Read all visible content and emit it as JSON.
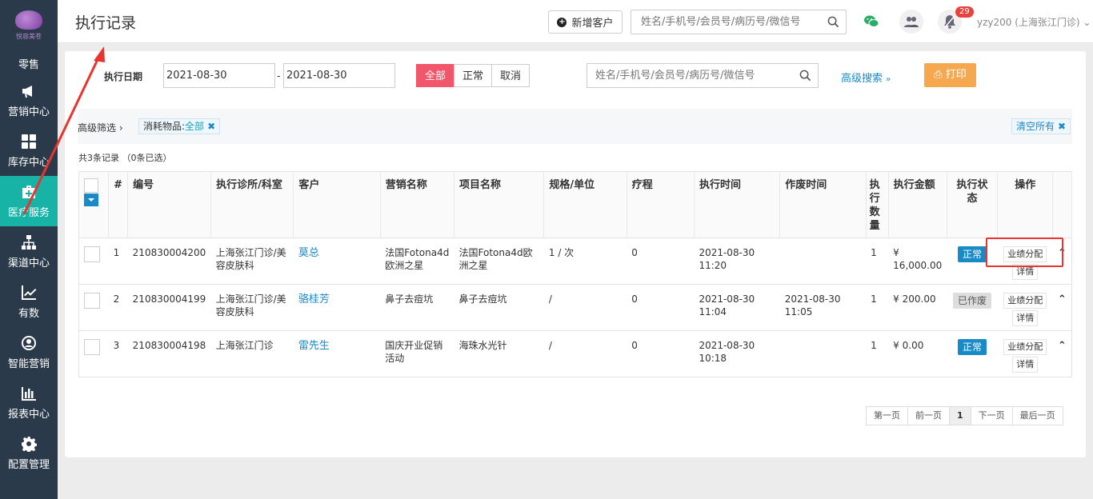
{
  "brand": {
    "logo_text": "悦容美苍"
  },
  "sidebar": {
    "items": [
      {
        "label": "零售",
        "icon": "retail-icon"
      },
      {
        "label": "营销中心",
        "icon": "megaphone-icon"
      },
      {
        "label": "库存中心",
        "icon": "grid-icon"
      },
      {
        "label": "医疗服务",
        "icon": "medical-kit-icon",
        "active": true
      },
      {
        "label": "渠道中心",
        "icon": "hierarchy-icon"
      },
      {
        "label": "有数",
        "icon": "trend-chart-icon"
      },
      {
        "label": "智能营销",
        "icon": "smart-icon"
      },
      {
        "label": "报表中心",
        "icon": "bar-chart-icon"
      },
      {
        "label": "配置管理",
        "icon": "gear-icon"
      }
    ]
  },
  "header": {
    "title": "执行记录",
    "add_customer": "新增客户",
    "search_placeholder": "姓名/手机号/会员号/病历号/微信号",
    "notification_count": "29",
    "user": "yzy200 (上海张江门诊)"
  },
  "filters": {
    "date_label": "执行日期",
    "date_from": "2021-08-30",
    "date_to": "2021-08-30",
    "dash": "-",
    "status_tabs": [
      "全部",
      "正常",
      "取消"
    ],
    "active_tab": "全部",
    "search_placeholder": "姓名/手机号/会员号/病历号/微信号",
    "advanced_search": "高级搜索",
    "print": "打印"
  },
  "advanced_bar": {
    "title": "高级筛选",
    "tag_key": "消耗物品:",
    "tag_value": "全部",
    "clear_all": "清空所有"
  },
  "record_count": "共3条记录 （0条已选）",
  "table": {
    "headers": [
      "#",
      "编号",
      "执行诊所/科室",
      "客户",
      "营销名称",
      "项目名称",
      "规格/单位",
      "疗程",
      "执行时间",
      "作废时间",
      "执行数量",
      "执行金额",
      "执行状态",
      "操作"
    ],
    "rows": [
      {
        "no": "1",
        "code": "210830004200",
        "clinic": "上海张江门诊/美容皮肤科",
        "customer": "莫总",
        "campaign": "法国Fotona4d欧洲之星",
        "project": "法国Fotona4d欧洲之星",
        "spec": "1 / 次",
        "course": "0",
        "exec_time": "2021-08-30 11:20",
        "void_time": "",
        "qty": "1",
        "amount": "¥ 16,000.00",
        "status": "正常",
        "status_type": "ok",
        "op1": "业绩分配",
        "op2": "详情"
      },
      {
        "no": "2",
        "code": "210830004199",
        "clinic": "上海张江门诊/美容皮肤科",
        "customer": "骆桂芳",
        "campaign": "鼻子去痘坑",
        "project": "鼻子去痘坑",
        "spec": "/",
        "course": "0",
        "exec_time": "2021-08-30 11:04",
        "void_time": "2021-08-30 11:05",
        "qty": "1",
        "amount": "¥ 200.00",
        "status": "已作废",
        "status_type": "void",
        "op1": "业绩分配",
        "op2": "详情"
      },
      {
        "no": "3",
        "code": "210830004198",
        "clinic": "上海张江门诊",
        "customer": "雷先生",
        "campaign": "国庆开业促销活动",
        "project": "海珠水光针",
        "spec": "/",
        "course": "0",
        "exec_time": "2021-08-30 10:18",
        "void_time": "",
        "qty": "1",
        "amount": "¥ 0.00",
        "status": "正常",
        "status_type": "ok",
        "op1": "业绩分配",
        "op2": "详情"
      }
    ]
  },
  "pager": {
    "first": "第一页",
    "prev": "前一页",
    "current": "1",
    "next": "下一页",
    "last": "最后一页"
  },
  "colors": {
    "sidebar": "#2b3a4a",
    "active_nav": "#17b3a6",
    "accent": "#1a8ac6",
    "tab_active": "#f2566b",
    "print": "#f6a84f",
    "annotation": "#e8342e"
  }
}
